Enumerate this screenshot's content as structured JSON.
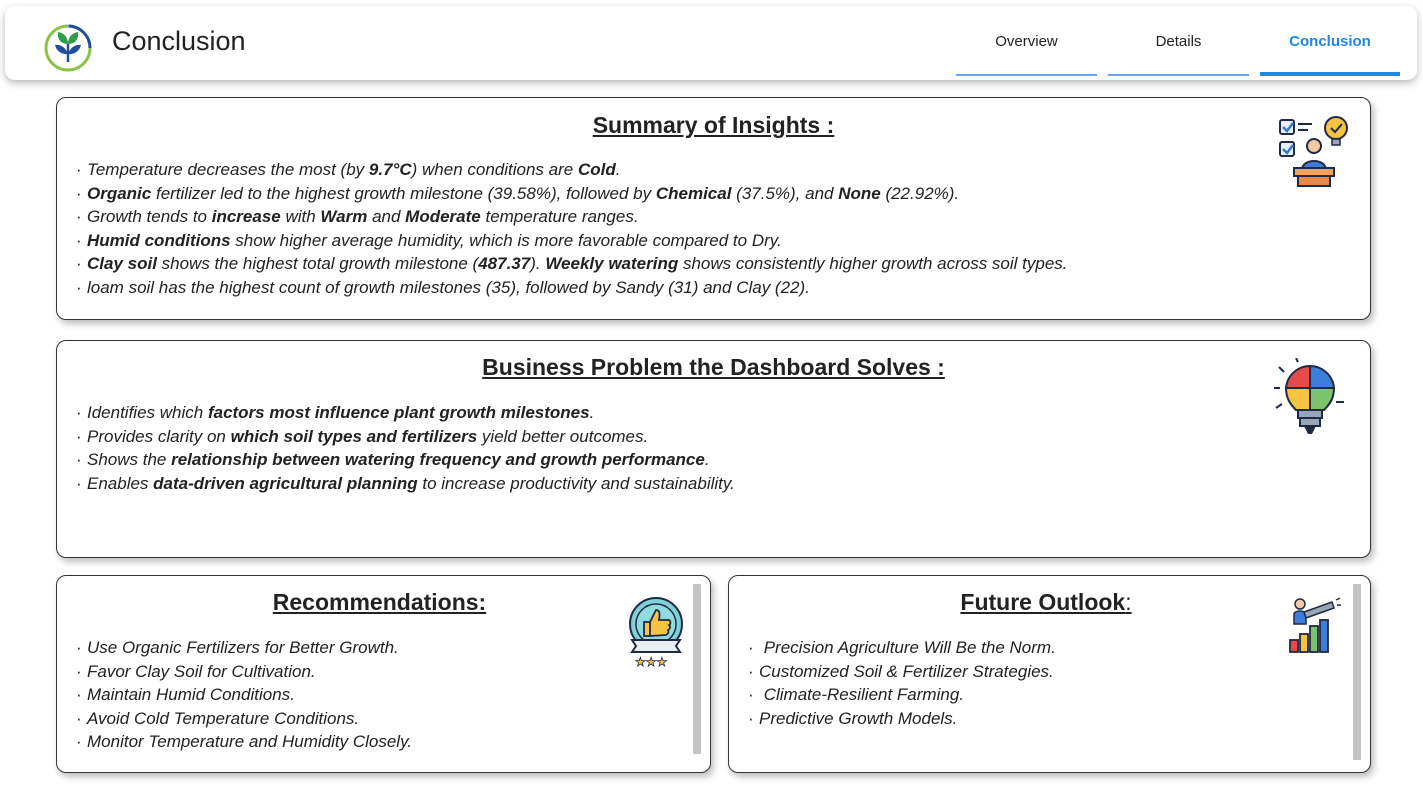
{
  "header": {
    "title": "Conclusion",
    "tabs": [
      {
        "label": "Overview",
        "active": false
      },
      {
        "label": "Details",
        "active": false
      },
      {
        "label": "Conclusion",
        "active": true
      }
    ]
  },
  "colors": {
    "accent": "#1e88e5",
    "logo_green": "#2e9e4a",
    "logo_blue": "#1f4e9a",
    "card_border": "#333333"
  },
  "insights": {
    "title": "Summary of Insights :",
    "icon": "checklist-person-lightbulb-icon",
    "items": [
      {
        "t1": "Temperature decreases the most (by ",
        "b1": "9.7°C",
        "t2": ") when conditions are ",
        "b2": "Cold",
        "t3": "."
      },
      {
        "b1": "Organic",
        "t1": " fertilizer led to the highest growth milestone (39.58%), followed by ",
        "b2": "Chemical",
        "t2": " (37.5%), and ",
        "b3": "None",
        "t3": " (22.92%)."
      },
      {
        "t1": "Growth tends to ",
        "b1": "increase",
        "t2": " with ",
        "b2": "Warm",
        "t3": " and ",
        "b3": "Moderate",
        "t4": " temperature ranges."
      },
      {
        "b1": "Humid conditions",
        "t1": " show higher average humidity, which is more favorable compared to Dry."
      },
      {
        "b1": "Clay soil",
        "t1": " shows the highest total growth milestone (",
        "b2": "487.37",
        "t2": "). ",
        "b3": "Weekly watering",
        "t3": " shows consistently higher growth across soil types."
      },
      {
        "t1": "loam soil has the highest count of growth milestones (35), followed by Sandy (31) and Clay (22)."
      }
    ]
  },
  "business": {
    "title": "Business Problem the Dashboard Solves :",
    "icon": "puzzle-lightbulb-icon",
    "items": [
      {
        "t1": "Identifies which ",
        "b1": "factors most influence plant growth milestones",
        "t2": "."
      },
      {
        "t1": "Provides clarity on ",
        "b1": "which soil types and fertilizers",
        "t2": " yield better outcomes."
      },
      {
        "t1": "Shows the ",
        "b1": "relationship between watering frequency and growth performance",
        "t2": "."
      },
      {
        "t1": "Enables ",
        "b1": "data-driven agricultural planning",
        "t2": " to increase productivity and sustainability."
      }
    ]
  },
  "recommendations": {
    "title": "Recommendations:",
    "icon": "thumbs-up-badge-icon",
    "items": [
      "Use Organic Fertilizers for Better Growth.",
      "Favor Clay Soil for Cultivation.",
      "Maintain Humid Conditions.",
      "Avoid Cold Temperature Conditions.",
      "Monitor Temperature and Humidity Closely."
    ]
  },
  "future": {
    "title_main": "Future Outlook",
    "title_suffix": ":",
    "icon": "telescope-growth-chart-icon",
    "items": [
      " Precision Agriculture Will Be the Norm.",
      "Customized Soil & Fertilizer Strategies.",
      " Climate-Resilient Farming.",
      "Predictive Growth Models."
    ]
  }
}
